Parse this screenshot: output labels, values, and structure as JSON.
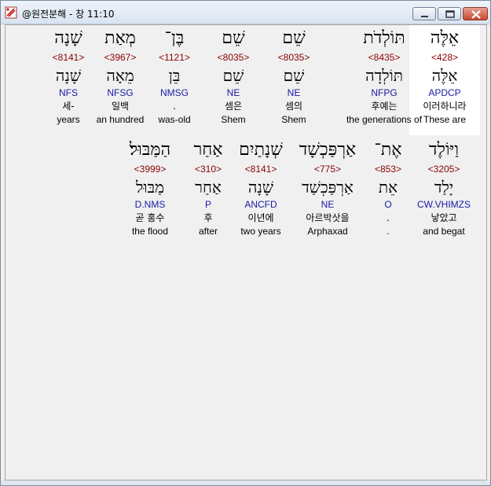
{
  "window": {
    "title": "@원전분해 - 창 11:10",
    "minimize_icon": "minimize-icon",
    "maximize_icon": "maximize-icon",
    "close_icon": "close-icon",
    "app_icon": "interlinear-app-icon"
  },
  "rows": [
    {
      "words": [
        {
          "heb": "אֵלֶּה",
          "strong": "<428>",
          "lemma": "אֵלֶּה",
          "morph": "APDCP",
          "korean": "이러하니라",
          "english": "These are",
          "selected": true
        },
        {
          "heb": "תּוֹלְדֹת",
          "strong": "<8435>",
          "lemma": "תּוֹלְדָה",
          "morph": "NFPG",
          "korean": "후예는",
          "english": "the generations of",
          "selected": false
        },
        {
          "heb": "שֵׁם",
          "strong": "<8035>",
          "lemma": "שֵׁם",
          "morph": "NE",
          "korean": "셈의",
          "english": "Shem",
          "selected": false
        },
        {
          "heb": "שֵׁם",
          "strong": "<8035>",
          "lemma": "שֵׁם",
          "morph": "NE",
          "korean": "셈은",
          "english": "Shem",
          "selected": false
        },
        {
          "heb": "בֶּן־",
          "strong": "<1121>",
          "lemma": "בֵּן",
          "morph": "NMSG",
          "korean": ".",
          "english": "was-old",
          "selected": false
        },
        {
          "heb": "מְאַת",
          "strong": "<3967>",
          "lemma": "מֵאָה",
          "morph": "NFSG",
          "korean": "일백",
          "english": "an hundred",
          "selected": false
        },
        {
          "heb": "שָׁנָה",
          "strong": "<8141>",
          "lemma": "שָׁנָה",
          "morph": "NFS",
          "korean": "세-",
          "english": "years",
          "selected": false
        }
      ]
    },
    {
      "words": [
        {
          "heb": "וַיּוֹלֶד",
          "strong": "<3205>",
          "lemma": "יָלַד",
          "morph": "CW.VHIMZS",
          "korean": "낳았고",
          "english": "and begat",
          "selected": false
        },
        {
          "heb": "אֶת־",
          "strong": "<853>",
          "lemma": "אֵת",
          "morph": "O",
          "korean": ".",
          "english": ".",
          "selected": false
        },
        {
          "heb": "אַרְפַּכְשָׁד",
          "strong": "<775>",
          "lemma": "אַרְפַּכְשַׁד",
          "morph": "NE",
          "korean": "아르박삿을",
          "english": "Arphaxad",
          "selected": false
        },
        {
          "heb": "שְׁנָתַיִם",
          "strong": "<8141>",
          "lemma": "שָׁנָה",
          "morph": "ANCFD",
          "korean": "이년에",
          "english": "two years",
          "selected": false
        },
        {
          "heb": "אַחַר",
          "strong": "<310>",
          "lemma": "אַחַר",
          "morph": "P",
          "korean": "후",
          "english": "after",
          "selected": false
        },
        {
          "heb": "הַמַּבּוּל׃",
          "strong": "<3999>",
          "lemma": "מַבּוּל",
          "morph": "D.NMS",
          "korean": "곧 홍수",
          "english": "the flood",
          "selected": false
        }
      ]
    }
  ],
  "colors": {
    "strong": "#8b0000",
    "morph": "#1a1aa6",
    "selected_bg": "#ffffff",
    "client_bg": "#f0f0f0"
  }
}
